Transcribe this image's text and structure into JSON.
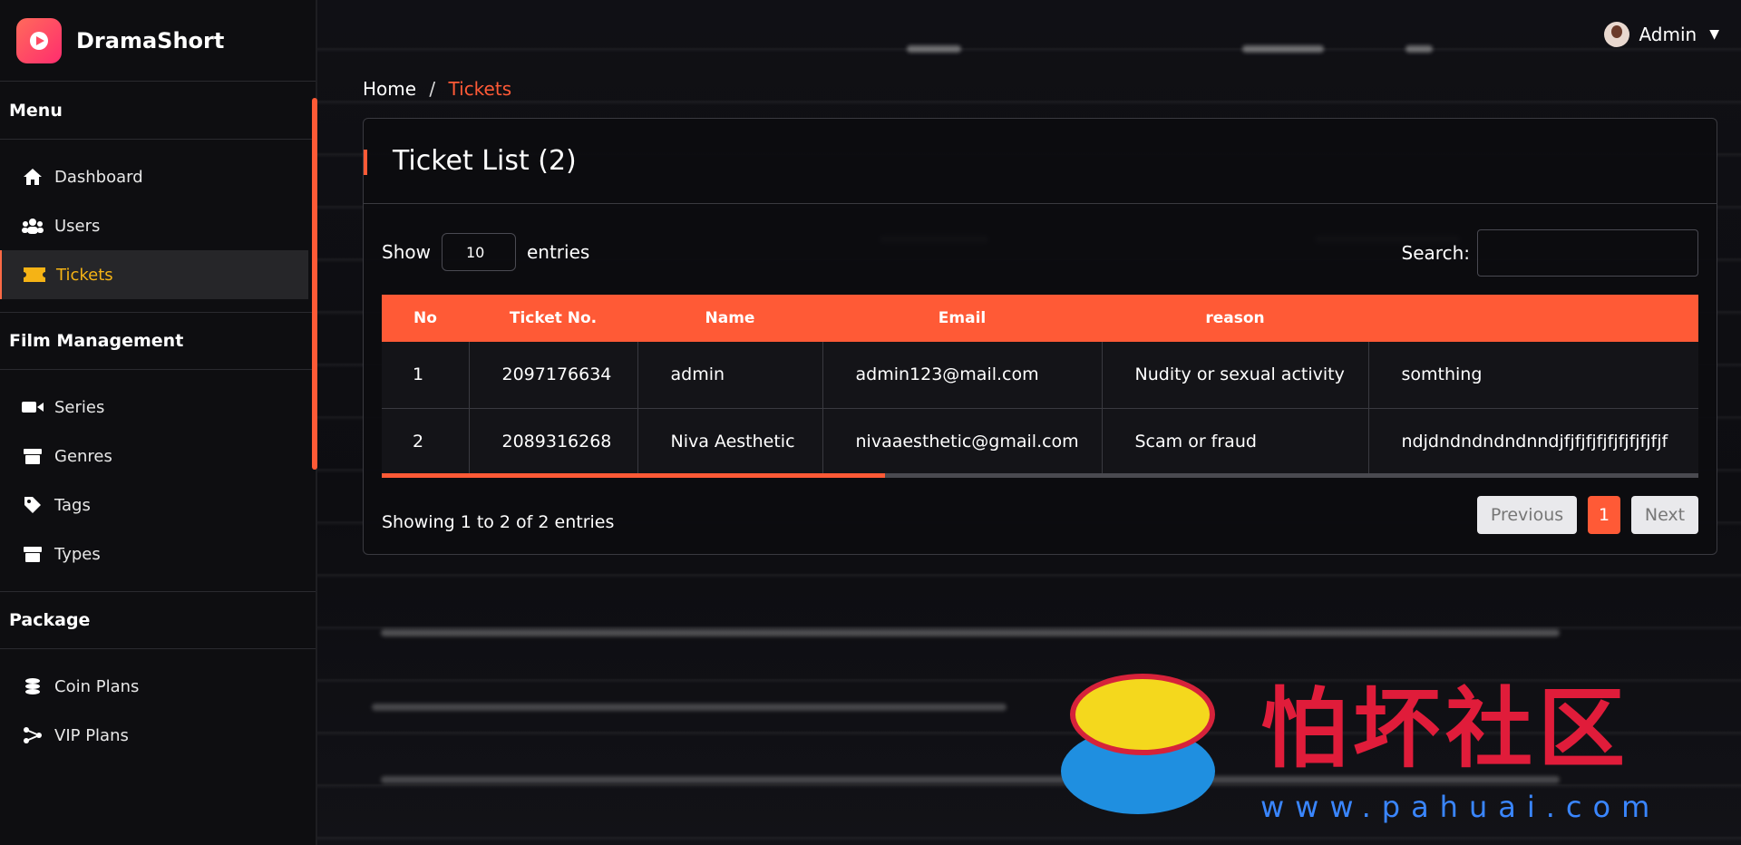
{
  "brand": {
    "name": "DramaShort"
  },
  "sidebar": {
    "sections": [
      {
        "title": "Menu",
        "items": [
          {
            "label": "Dashboard",
            "icon": "home-icon"
          },
          {
            "label": "Users",
            "icon": "users-icon"
          },
          {
            "label": "Tickets",
            "icon": "ticket-icon",
            "active": true
          }
        ]
      },
      {
        "title": "Film Management",
        "items": [
          {
            "label": "Series",
            "icon": "video-icon"
          },
          {
            "label": "Genres",
            "icon": "box-icon"
          },
          {
            "label": "Tags",
            "icon": "tag-icon"
          },
          {
            "label": "Types",
            "icon": "box-icon"
          }
        ]
      },
      {
        "title": "Package",
        "items": [
          {
            "label": "Coin Plans",
            "icon": "coins-icon"
          },
          {
            "label": "VIP Plans",
            "icon": "share-icon"
          }
        ]
      }
    ]
  },
  "header": {
    "user": "Admin"
  },
  "breadcrumb": {
    "home": "Home",
    "separator": "/",
    "current": "Tickets"
  },
  "card": {
    "title": "Ticket List (2)",
    "show_label": "Show",
    "entries_value": "10",
    "entries_label": "entries",
    "search_label": "Search:",
    "search_value": ""
  },
  "table": {
    "columns": [
      "No",
      "Ticket No.",
      "Name",
      "Email",
      "reason",
      ""
    ],
    "rows": [
      [
        "1",
        "2097176634",
        "admin",
        "admin123@mail.com",
        "Nudity or sexual activity",
        "somthing"
      ],
      [
        "2",
        "2089316268",
        "Niva Aesthetic",
        "nivaaesthetic@gmail.com",
        "Scam or fraud",
        "ndjdndndndndnndjfjfjfjfjfjfjfjfjfjf"
      ]
    ]
  },
  "footer": {
    "info": "Showing 1 to 2 of 2 entries",
    "previous": "Previous",
    "page": "1",
    "next": "Next"
  },
  "watermark": {
    "text": "怕坏社区",
    "url": "www.pahuai.com"
  },
  "colors": {
    "accent": "#ff5a36",
    "active_text": "#f5b315",
    "background": "#0b0b0e"
  }
}
